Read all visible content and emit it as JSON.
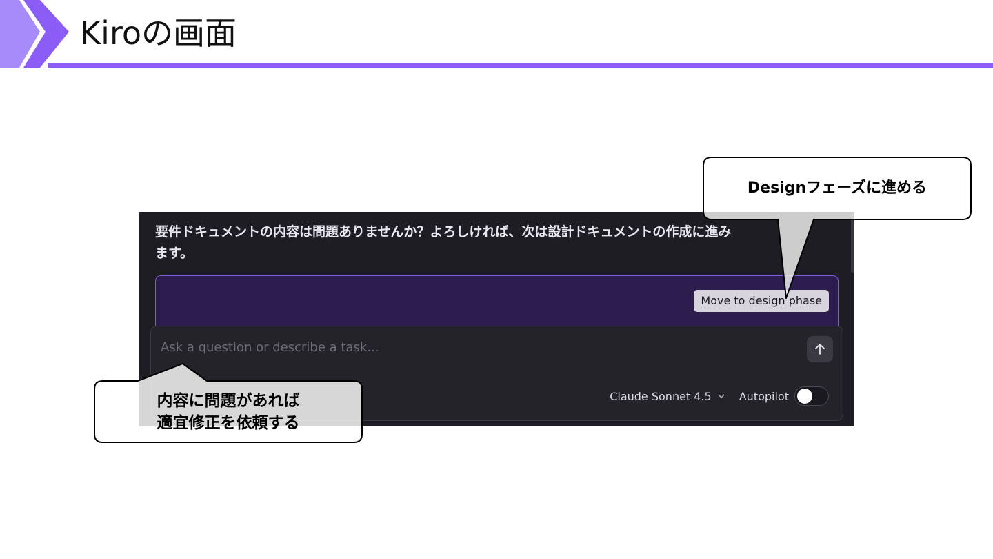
{
  "slide": {
    "title": "Kiroの画面",
    "accent_color": "#8b5cf6"
  },
  "kiro": {
    "message": "要件ドキュメントの内容は問題ありませんか？よろしければ、次は設計ドキュメントの作成に進み\nます。",
    "action_button_label": "Move to design phase",
    "chat": {
      "placeholder": "Ask a question or describe a task...",
      "send_icon": "arrow-up-icon",
      "model_label": "Claude Sonnet 4.5",
      "autopilot_label": "Autopilot",
      "autopilot_on": false
    },
    "colors": {
      "panel_bg": "#1e1d23",
      "card_bg": "#2d1d4f",
      "card_border": "#7c5cd6"
    }
  },
  "callouts": {
    "top": "Designフェーズに進める",
    "bottom": [
      "内容に問題があれば",
      "適宜修正を依頼する"
    ]
  }
}
